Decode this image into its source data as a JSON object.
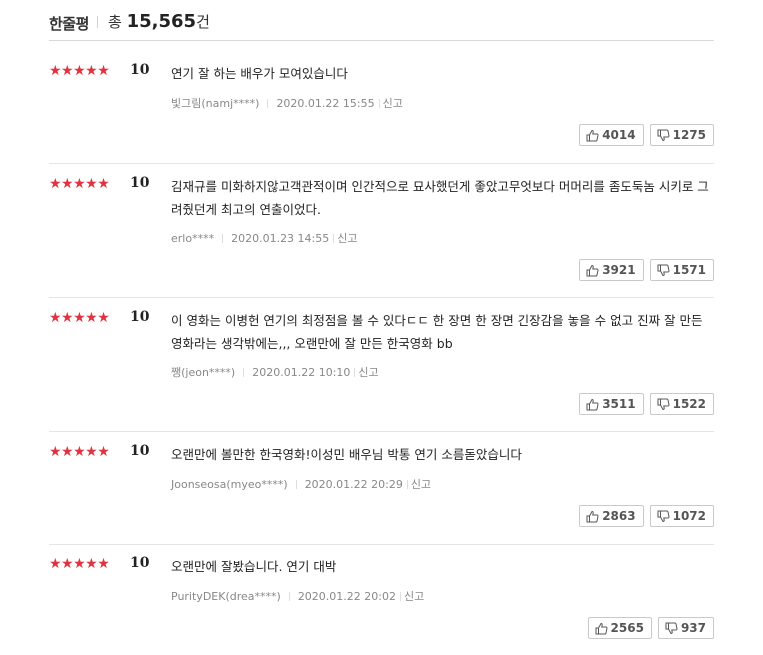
{
  "header": {
    "title": "한줄평",
    "total_label": "총",
    "total_count": "15,565",
    "total_unit": "건"
  },
  "reviews": [
    {
      "stars": "★★★★★",
      "score": "10",
      "text": "연기 잘 하는 배우가 모여있습니다",
      "user": "빛그림(namj****)",
      "date": "2020.01.22 15:55",
      "report": "신고",
      "likes": "4014",
      "dislikes": "1275"
    },
    {
      "stars": "★★★★★",
      "score": "10",
      "text": "김재규를 미화하지않고객관적이며 인간적으로 묘사했던게 좋았고무엇보다 머머리를 좀도둑놈 시키로 그려줬던게 최고의 연출이었다.",
      "user": "erlo****",
      "date": "2020.01.23 14:55",
      "report": "신고",
      "likes": "3921",
      "dislikes": "1571"
    },
    {
      "stars": "★★★★★",
      "score": "10",
      "text": "이 영화는 이병헌 연기의 최정점을 볼 수 있다ㄷㄷ 한 장면 한 장면 긴장감을 놓을 수 없고 진짜 잘 만든 영화라는 생각밖에는,,, 오랜만에 잘 만든 한국영화 bb",
      "user": "쨍(jeon****)",
      "date": "2020.01.22 10:10",
      "report": "신고",
      "likes": "3511",
      "dislikes": "1522"
    },
    {
      "stars": "★★★★★",
      "score": "10",
      "text": "오랜만에 볼만한 한국영화!이성민 배우님 박통 연기 소름돋았습니다",
      "user": "Joonseosa(myeo****)",
      "date": "2020.01.22 20:29",
      "report": "신고",
      "likes": "2863",
      "dislikes": "1072"
    },
    {
      "stars": "★★★★★",
      "score": "10",
      "text": "오랜만에 잘봤습니다. 연기 대박",
      "user": "PurityDEK(drea****)",
      "date": "2020.01.22 20:02",
      "report": "신고",
      "likes": "2565",
      "dislikes": "937"
    }
  ],
  "icons": {
    "like": "thumbs-up-icon",
    "dislike": "thumbs-down-icon"
  },
  "colors": {
    "star": "#e3323f"
  }
}
